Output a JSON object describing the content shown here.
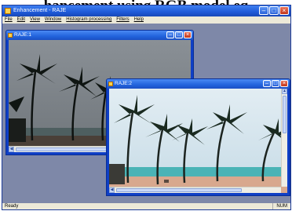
{
  "caption": "hancement using RGB model eq",
  "app": {
    "title": "Enhancement - RAJE",
    "menu": [
      "File",
      "Edit",
      "View",
      "Window",
      "Histogram processing",
      "Filters",
      "Help"
    ],
    "status_left": "Ready",
    "status_right": "NUM"
  },
  "windows": [
    {
      "title": "RAJE:1"
    },
    {
      "title": "RAJE:2"
    }
  ]
}
